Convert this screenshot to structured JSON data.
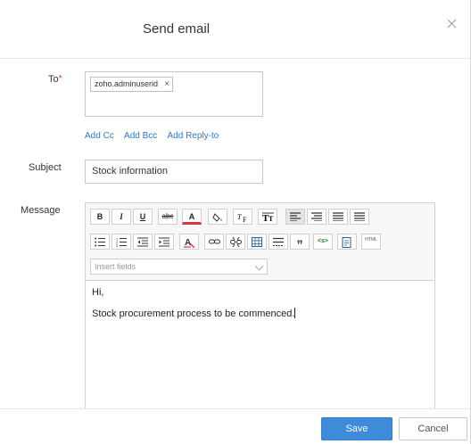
{
  "dialog": {
    "title": "Send email",
    "close_icon": "close-icon"
  },
  "form": {
    "to_label": "To",
    "required_mark": "*",
    "to_recipients": [
      {
        "value": "zoho.adminuserid",
        "remove_glyph": "×"
      }
    ],
    "links": [
      "Add Cc",
      "Add Bcc",
      "Add Reply-to"
    ],
    "subject_label": "Subject",
    "subject_value": "Stock information",
    "message_label": "Message"
  },
  "toolbar": {
    "row1": [
      "bold",
      "italic",
      "underline",
      "strikethrough",
      "font-color",
      "background-color",
      "font-family",
      "font-size",
      "align-left",
      "align-center",
      "align-right",
      "align-justify"
    ],
    "row2": [
      "bulleted-list",
      "numbered-list",
      "indent-decrease",
      "indent-increase",
      "clear-format",
      "insert-link",
      "remove-link",
      "insert-table",
      "horizontal-line",
      "quote",
      "source-code",
      "insert-template",
      "html"
    ],
    "labels": {
      "bold": "B",
      "italic": "I",
      "underline": "U",
      "strikethrough": "abc",
      "font_color": "A",
      "quote": "”",
      "source_code": "<s>",
      "html": "HTML"
    },
    "insert_fields_placeholder": "Insert fields"
  },
  "message_body": {
    "line1": "Hi,",
    "line2": "Stock procurement process to be commenced."
  },
  "footer": {
    "save_label": "Save",
    "cancel_label": "Cancel"
  },
  "colors": {
    "primary": "#3d8bd9",
    "link": "#2f7ac9",
    "required": "#e0302f"
  }
}
